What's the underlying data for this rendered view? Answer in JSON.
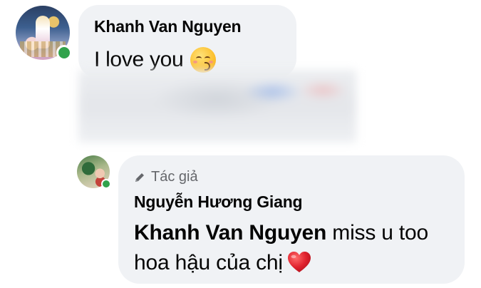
{
  "comments": [
    {
      "author": "Khanh Van Nguyen",
      "text": "I love you",
      "emoji": "kissing-face-with-closed-eyes",
      "online": true,
      "has_blurred_attachment": true
    }
  ],
  "reply": {
    "badge_icon": "pencil-icon",
    "badge_label": "Tác giả",
    "author": "Nguyễn Hương Giang",
    "mention": "Khanh Van Nguyen",
    "text": " miss u too hoa hậu của chị",
    "emoji": "red-heart",
    "online": true
  },
  "colors": {
    "bubble": "#f0f2f5",
    "online": "#31a24c",
    "secondary_text": "#65676b",
    "heart": "#e0222e"
  }
}
